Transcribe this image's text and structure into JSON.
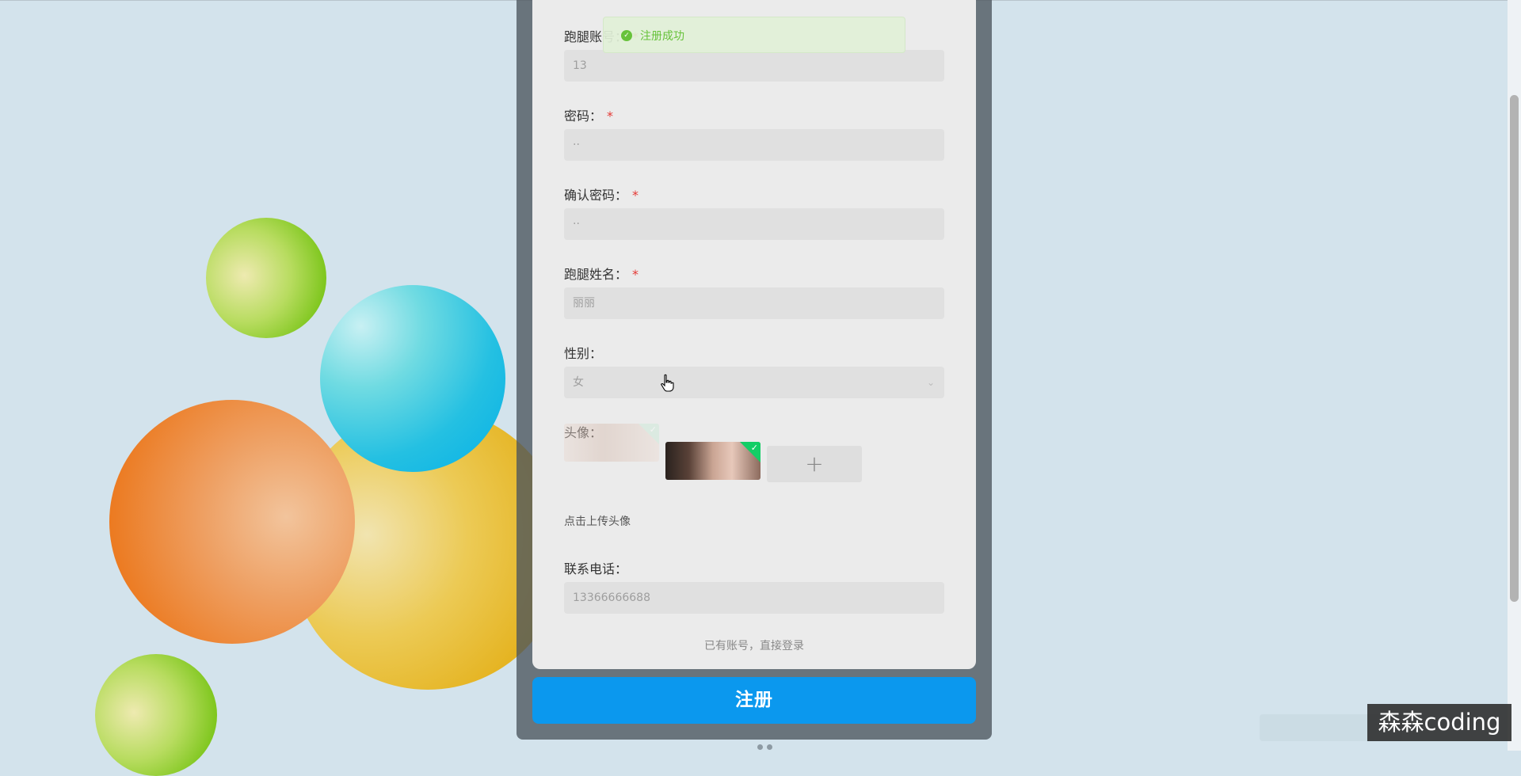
{
  "toast": {
    "message": "注册成功",
    "icon": "check-circle-icon",
    "color": "#67c23a"
  },
  "form": {
    "fields": [
      {
        "label": "跑腿账号：",
        "required": true,
        "value": "13"
      },
      {
        "label": "密码：",
        "required": true,
        "value": "··"
      },
      {
        "label": "确认密码：",
        "required": true,
        "value": "··"
      },
      {
        "label": "跑腿姓名：",
        "required": true,
        "value": "丽丽"
      },
      {
        "label": "性别：",
        "required": false,
        "value": "女",
        "type": "select",
        "icon": "chevron-down-icon"
      },
      {
        "label": "头像：",
        "required": false,
        "type": "upload"
      },
      {
        "label": "联系电话：",
        "required": false,
        "value": "13366666688"
      }
    ],
    "required_mark": "*",
    "upload": {
      "plus_glyph": "+",
      "hint": "点击上传头像",
      "uploaded_count": 2
    },
    "login_link": "已有账号，直接登录"
  },
  "register_button": {
    "label": "注册",
    "color": "#0b98ee"
  },
  "watermark": "森森coding",
  "colors": {
    "background": "#d3e3ec",
    "card": "#ebebeb",
    "required": "#e53935",
    "success": "#13ce66"
  }
}
